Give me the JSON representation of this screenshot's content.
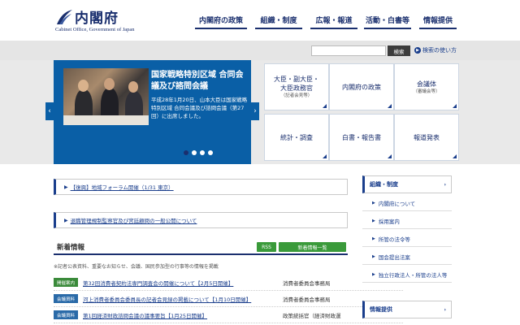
{
  "header": {
    "logo_title": "内閣府",
    "logo_sub": "Cabinet Office, Government of Japan",
    "nav": [
      "内閣府の政策",
      "組織・制度",
      "広報・報道",
      "活動・白書等",
      "情報提供"
    ]
  },
  "search": {
    "button_label": "検索",
    "help_label": "検索の使い方"
  },
  "slider": {
    "title": "国家戦略特別区域 合同会議及び諮問会議",
    "text": "平成28年1月20日、山本大臣は国家戦略特別区域 合同会議及び諮問会議（第27回）に出席しました。",
    "prev": "‹",
    "next": "›"
  },
  "tiles": [
    {
      "label": "大臣・副大臣・大臣政務官",
      "sub": "（記者会見等）"
    },
    {
      "label": "内閣府の政策",
      "sub": ""
    },
    {
      "label": "会議体",
      "sub": "（審議会等）"
    },
    {
      "label": "統計・調査",
      "sub": ""
    },
    {
      "label": "白書・報告書",
      "sub": ""
    },
    {
      "label": "報道発表",
      "sub": ""
    }
  ],
  "notices": [
    "【復興】地域フォーラム開催（1/31 東京）",
    "退職管理規制監察官及び宮廷顧問の一般公開について"
  ],
  "news": {
    "title": "新着情報",
    "rss_label": "RSS",
    "list_label": "新着情報一覧",
    "note": "※記者公表資料、重要なお知らせ、会議、国民参加型の行事等の情報を掲載",
    "rows": [
      {
        "badge": "開催案内",
        "badge_color": "#3a8a3a",
        "link": "第32回消費者契約法専門調査会の開催について【2月5日開催】",
        "org": "消費者委員会事務局"
      },
      {
        "badge": "会議資料",
        "badge_color": "#2a6aa8",
        "link": "河上消費者委員会委員長の記者会見録の掲載について【1月10日開催】",
        "org": "消費者委員会事務局"
      },
      {
        "badge": "会議資料",
        "badge_color": "#2a6aa8",
        "link": "第1回経済財政諮問会議の議事要旨【1月25日開催】",
        "org": "政策統括官（経済財政運"
      }
    ]
  },
  "sidebar": {
    "section1": "組織・制度",
    "items": [
      "内閣府について",
      "採用案内",
      "所管の法令等",
      "国会提出法案",
      "独立行政法人・所管の法人等"
    ],
    "section2": "情報提供"
  },
  "colors": {
    "brand_navy": "#1a2f6e",
    "slider_blue": "#0a5fa6",
    "green_button": "#3a9a3a"
  }
}
